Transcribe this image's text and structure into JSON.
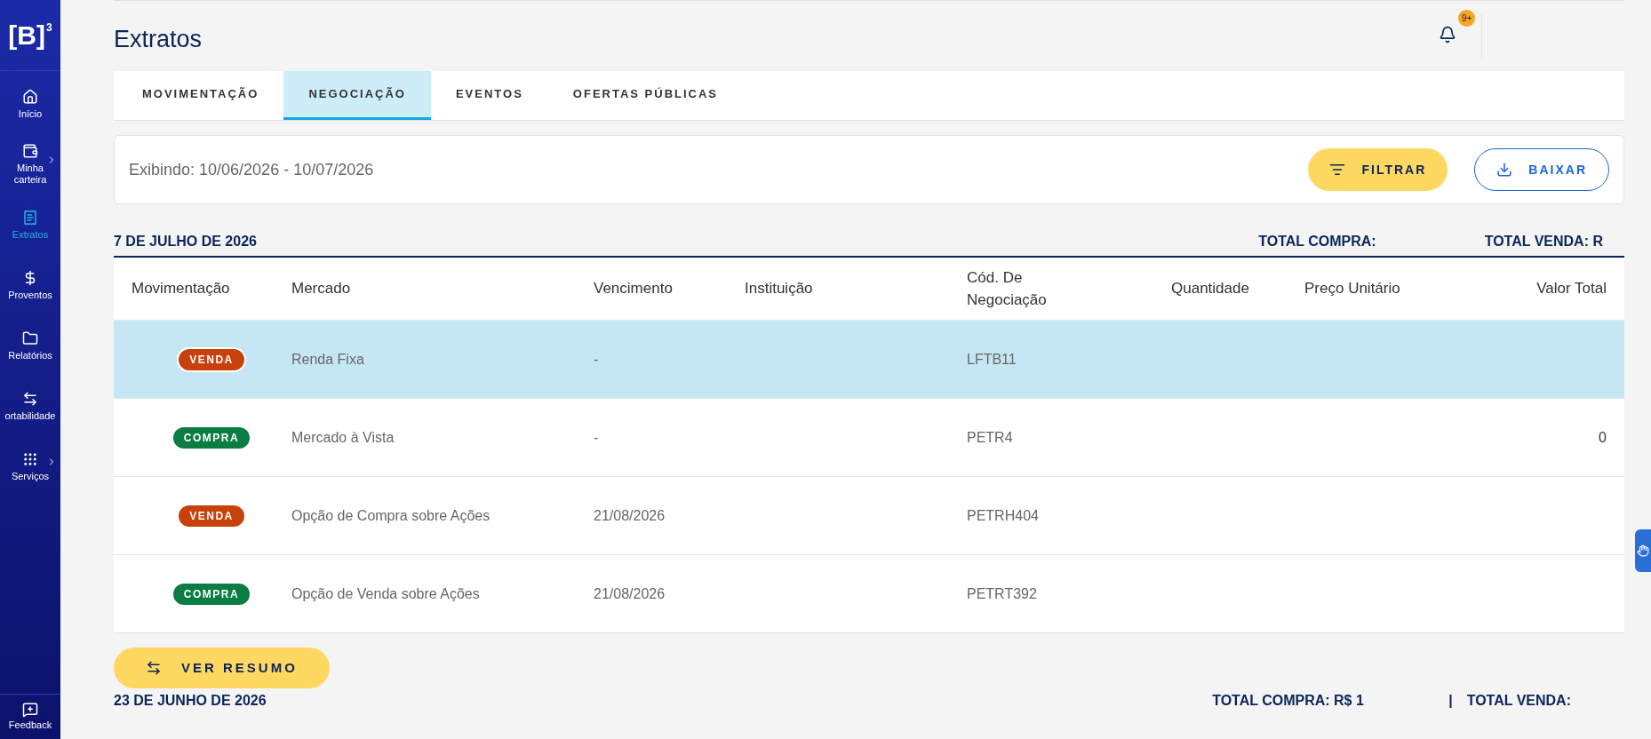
{
  "sidebar": {
    "logo": {
      "letter": "[B]",
      "superscript": "3"
    },
    "items": [
      {
        "label": "Início",
        "selected": false,
        "has_submenu": false
      },
      {
        "label": "Minha carteira",
        "selected": false,
        "has_submenu": true
      },
      {
        "label": "Extratos",
        "selected": true,
        "has_submenu": false
      },
      {
        "label": "Proventos",
        "selected": false,
        "has_submenu": false
      },
      {
        "label": "Relatórios",
        "selected": false,
        "has_submenu": false
      },
      {
        "label": "ortabilidade",
        "selected": false,
        "has_submenu": false
      },
      {
        "label": "Serviços",
        "selected": false,
        "has_submenu": true
      }
    ],
    "footer": {
      "label": "Feedback"
    }
  },
  "page_title": "Extratos",
  "notifications": {
    "badge": "9+"
  },
  "tabs": [
    {
      "label": "MOVIMENTAÇÃO",
      "selected": false
    },
    {
      "label": "NEGOCIAÇÃO",
      "selected": true
    },
    {
      "label": "EVENTOS",
      "selected": false
    },
    {
      "label": "OFERTAS PÚBLICAS",
      "selected": false
    }
  ],
  "filter_bar": {
    "period": "Exibindo: 10/06/2026 - 10/07/2026",
    "filter_button": "FILTRAR",
    "download_button": "BAIXAR"
  },
  "groups": [
    {
      "date": "7 DE JULHO DE 2026",
      "total_buy": "TOTAL COMPRA:",
      "total_sell": "TOTAL VENDA: R"
    }
  ],
  "table": {
    "columns": [
      "Movimentação",
      "Mercado",
      "Vencimento",
      "Instituição",
      "Cód. De Negociação",
      "Quantidade",
      "Preço Unitário",
      "Valor Total"
    ],
    "rows": [
      {
        "movement": "VENDA",
        "kind": "sell",
        "market": "Renda Fixa",
        "maturity": "-",
        "code": "LFTB11",
        "selected": true
      },
      {
        "movement": "COMPRA",
        "kind": "buy",
        "market": "Mercado à Vista",
        "maturity": "-",
        "code": "PETR4",
        "total": "0",
        "selected": false
      },
      {
        "movement": "VENDA",
        "kind": "sell",
        "market": "Opção de Compra sobre Ações",
        "maturity": "21/08/2026",
        "code": "PETRH404",
        "selected": false
      },
      {
        "movement": "COMPRA",
        "kind": "buy",
        "market": "Opção de Venda sobre Ações",
        "maturity": "21/08/2026",
        "code": "PETRT392",
        "selected": false
      }
    ]
  },
  "summary_button": "VER RESUMO",
  "next_group": {
    "date": "23 DE JUNHO DE 2026",
    "total_buy": "TOTAL COMPRA: R$ 1",
    "separator": "|",
    "total_sell": "TOTAL VENDA:"
  }
}
